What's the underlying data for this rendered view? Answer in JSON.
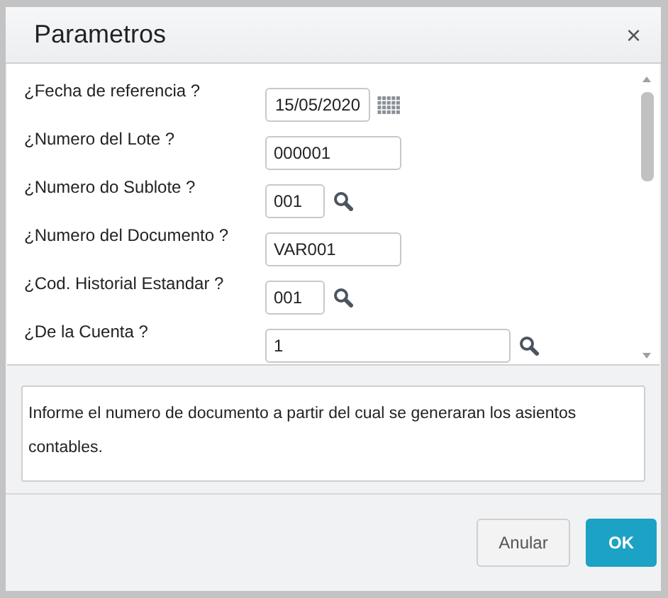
{
  "dialog": {
    "title": "Parametros",
    "close": "×"
  },
  "fields": [
    {
      "label": "¿Fecha de referencia ?",
      "value": "15/05/2020",
      "kind": "date"
    },
    {
      "label": "¿Numero del Lote ?",
      "value": "000001",
      "kind": "text"
    },
    {
      "label": "¿Numero do Sublote ?",
      "value": "001",
      "kind": "short-lookup"
    },
    {
      "label": "¿Numero del Documento ?",
      "value": "VAR001",
      "kind": "text"
    },
    {
      "label": "¿Cod. Historial Estandar ?",
      "value": "001",
      "kind": "short-lookup"
    },
    {
      "label": "¿De la Cuenta ?",
      "value": "1",
      "kind": "long-lookup"
    }
  ],
  "help": "Informe el numero de documento a partir del cual se generaran los asientos contables.",
  "buttons": [
    {
      "label": "Anular",
      "kind": "secondary"
    },
    {
      "label": "OK",
      "kind": "primary"
    }
  ]
}
